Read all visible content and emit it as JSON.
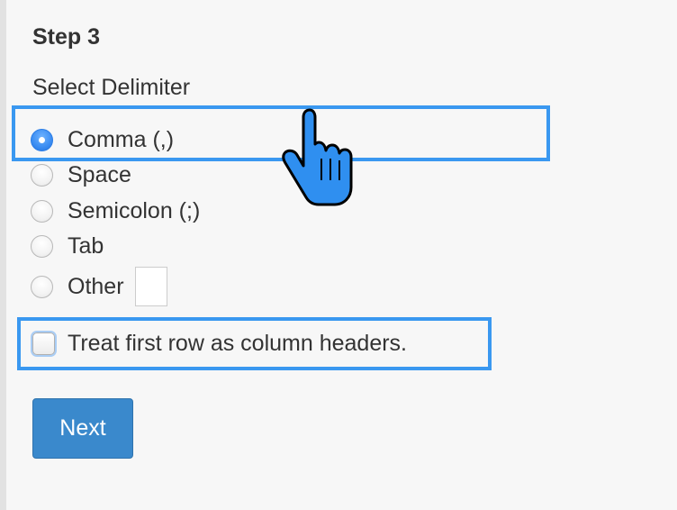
{
  "step": {
    "title": "Step 3"
  },
  "delimiter": {
    "label": "Select Delimiter",
    "selected": "Comma (,)",
    "options": [
      {
        "label": "Comma (,)"
      },
      {
        "label": "Space"
      },
      {
        "label": "Semicolon (;)"
      },
      {
        "label": "Tab"
      },
      {
        "label": "Other"
      }
    ],
    "other_value": ""
  },
  "headers_option": {
    "label": "Treat first row as column headers.",
    "checked": false
  },
  "actions": {
    "next_label": "Next"
  },
  "colors": {
    "highlight": "#3a98f0",
    "button": "#3a89cc",
    "selected_radio": "#3b8df2",
    "cursor": "#2f8ff0"
  },
  "icons": {
    "cursor": "hand-pointer-icon"
  }
}
